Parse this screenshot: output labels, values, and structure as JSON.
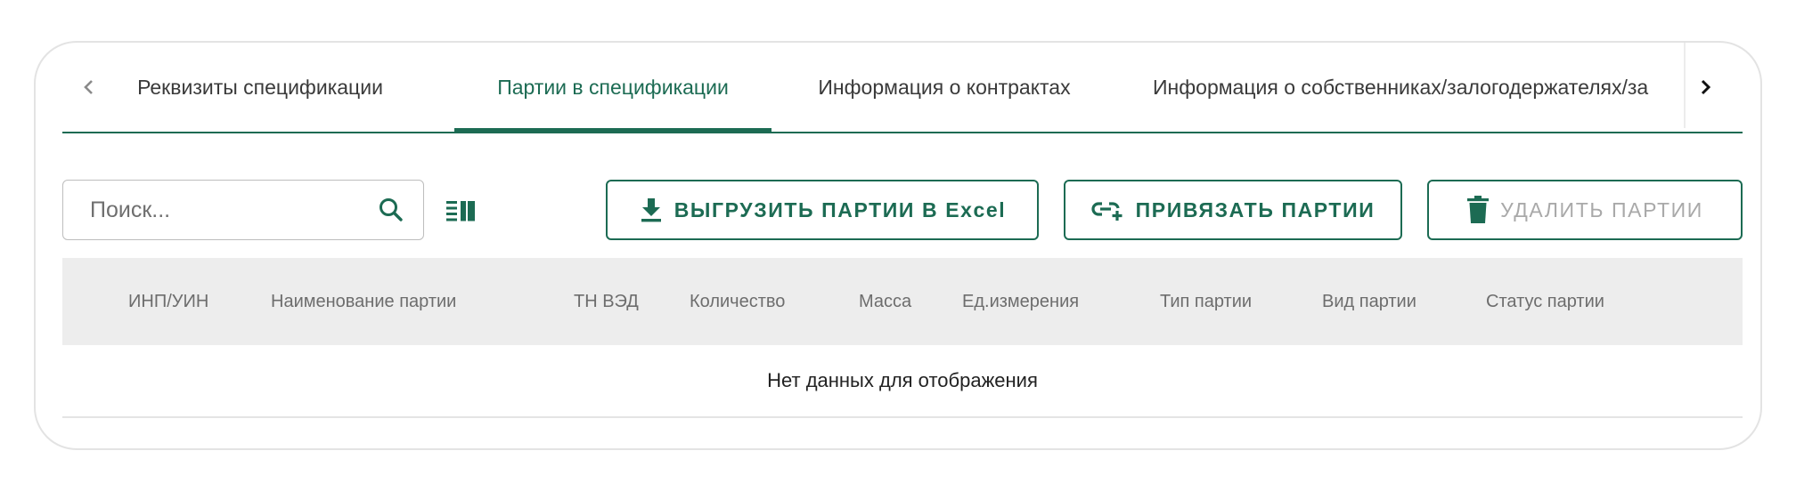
{
  "tabs": [
    {
      "label": "Реквизиты спецификации",
      "active": false
    },
    {
      "label": "Партии в спецификации",
      "active": true
    },
    {
      "label": "Информация о контрактах",
      "active": false
    },
    {
      "label": "Информация о собственниках/залогодержателях/за",
      "active": false
    }
  ],
  "search": {
    "placeholder": "Поиск..."
  },
  "buttons": {
    "export": "ВЫГРУЗИТЬ ПАРТИИ В Excel",
    "bind": "ПРИВЯЗАТЬ ПАРТИИ",
    "delete": "УДАЛИТЬ ПАРТИИ"
  },
  "table": {
    "columns": [
      "ИНП/УИН",
      "Наименование партии",
      "ТН ВЭД",
      "Количество",
      "Масса",
      "Ед.измерения",
      "Тип партии",
      "Вид партии",
      "Статус партии"
    ],
    "empty_message": "Нет данных для отображения"
  },
  "colors": {
    "accent": "#1c6b53",
    "disabled": "#a9a9a9",
    "header_bg": "#ededed"
  },
  "icons": [
    "chevron-left-icon",
    "chevron-right-icon",
    "search-icon",
    "columns-icon",
    "download-icon",
    "link-add-icon",
    "trash-icon"
  ]
}
